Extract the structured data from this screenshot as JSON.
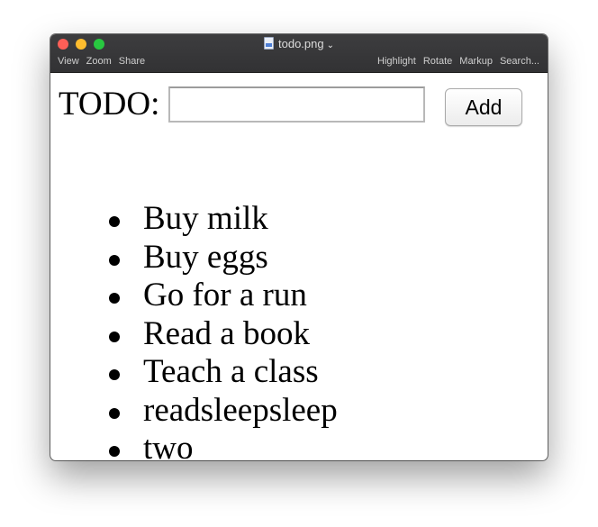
{
  "window": {
    "title": "todo.png",
    "toolbar_left": [
      "View",
      "Zoom",
      "Share"
    ],
    "toolbar_right": [
      "Highlight",
      "Rotate",
      "Markup",
      "Search..."
    ]
  },
  "app": {
    "label": "TODO:",
    "input_value": "",
    "add_label": "Add",
    "items": [
      "Buy milk",
      "Buy eggs",
      "Go for a run",
      "Read a book",
      "Teach a class",
      "readsleepsleep",
      "two"
    ]
  }
}
